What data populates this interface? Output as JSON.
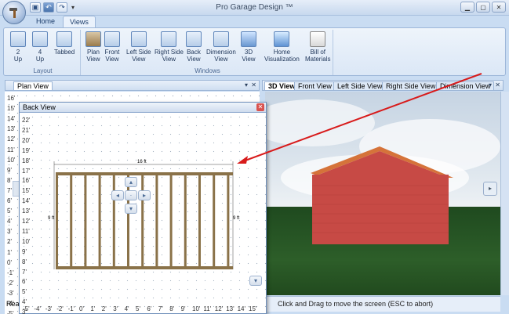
{
  "app": {
    "title": "Pro Garage Design ™"
  },
  "ribbon": {
    "tabs": [
      "Home",
      "Views"
    ],
    "groups": {
      "layout": {
        "label": "Layout",
        "buttons": [
          "2\nUp",
          "4\nUp",
          "Tabbed"
        ]
      },
      "windows": {
        "label": "Windows",
        "buttons": [
          "Plan\nView",
          "Front\nView",
          "Left Side\nView",
          "Right Side\nView",
          "Back\nView",
          "Dimension\nView",
          "3D\nView",
          "Home\nVisualization",
          "Bill of\nMaterials"
        ]
      }
    }
  },
  "plan_panel": {
    "tab": "Plan View",
    "status": "Rea",
    "ruler": [
      "16'",
      "15'",
      "14'",
      "13'",
      "12'",
      "11'",
      "10'",
      "9'",
      "8'",
      "7'",
      "6'",
      "5'",
      "4'",
      "3'",
      "2'",
      "1'",
      "0'",
      "-1'",
      "-2'",
      "-3'",
      "-4'",
      "-5'",
      "-6'"
    ]
  },
  "right_panel": {
    "tabs": [
      "3D View",
      "Front View",
      "Left Side View",
      "Right Side View",
      "Dimension View"
    ],
    "status": "Click and Drag to move the screen  (ESC to abort)"
  },
  "back_view": {
    "title": "Back View",
    "y_ruler": [
      "22'",
      "21'",
      "20'",
      "19'",
      "18'",
      "17'",
      "16'",
      "15'",
      "14'",
      "13'",
      "12'",
      "11'",
      "10'",
      "9'",
      "8'",
      "7'",
      "6'",
      "5'",
      "4'",
      "3'"
    ],
    "x_ruler": [
      "-5'",
      "-4'",
      "-3'",
      "-2'",
      "-1'",
      "0'",
      "1'",
      "2'",
      "3'",
      "4'",
      "5'",
      "6'",
      "7'",
      "8'",
      "9'",
      "10'",
      "11'",
      "12'",
      "13'",
      "14'",
      "15'"
    ],
    "width_label": "16 ft",
    "height_left": "9 ft",
    "height_right": "9 ft"
  },
  "colors": {
    "wall": "#c74a45",
    "roof": "#d5733a",
    "grass": "#2d5e29",
    "arrow": "#d81b1b",
    "stud": "#8a7249"
  }
}
